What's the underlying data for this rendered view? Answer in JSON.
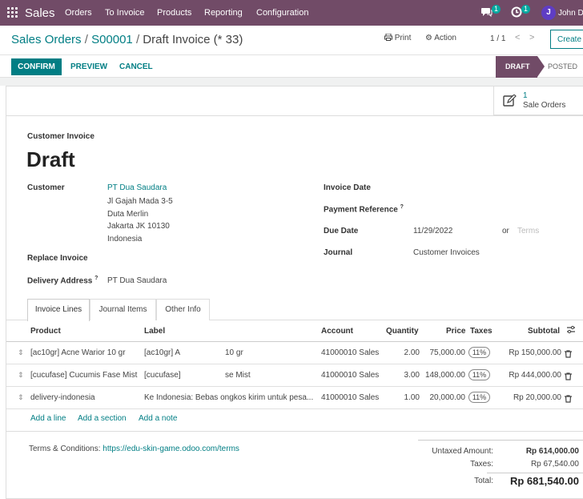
{
  "topbar": {
    "app_name": "Sales",
    "menu": [
      "Orders",
      "To Invoice",
      "Products",
      "Reporting",
      "Configuration"
    ],
    "messages_count": "1",
    "activities_count": "1",
    "user_initial": "J",
    "user_name": "John D",
    "accent": "#714b67"
  },
  "breadcrumb": {
    "root": "Sales Orders",
    "order": "S00001",
    "current": "Draft Invoice (* 33)"
  },
  "control": {
    "print_label": "Print",
    "action_label": "Action",
    "pager": "1 / 1",
    "create_label": "Create"
  },
  "actions": {
    "confirm": "CONFIRM",
    "preview": "PREVIEW",
    "cancel": "CANCEL"
  },
  "statusbar": {
    "draft": "DRAFT",
    "posted": "POSTED"
  },
  "smart_button": {
    "count": "1",
    "label": "Sale Orders"
  },
  "invoice": {
    "type_label": "Customer Invoice",
    "title": "Draft",
    "customer_label": "Customer",
    "customer_address": [
      "PT Dua Saudara",
      "Jl Gajah Mada 3-5",
      "Duta Merlin",
      "Jakarta JK 10130",
      "Indonesia"
    ],
    "replace_invoice_label": "Replace Invoice",
    "delivery_address_label": "Delivery Address",
    "delivery_address_help": "?",
    "delivery_address": "PT Dua Saudara",
    "invoice_date_label": "Invoice Date",
    "payment_ref_label": "Payment Reference",
    "payment_ref_help": "?",
    "due_date_label": "Due Date",
    "due_date": "11/29/2022",
    "or": "or",
    "terms_placeholder": "Terms",
    "journal_label": "Journal",
    "journal": "Customer Invoices"
  },
  "tabs": [
    "Invoice Lines",
    "Journal Items",
    "Other Info"
  ],
  "table": {
    "headers": {
      "product": "Product",
      "label": "Label",
      "account": "Account",
      "quantity": "Quantity",
      "price": "Price",
      "taxes": "Taxes",
      "subtotal": "Subtotal"
    },
    "rows": [
      {
        "product": "[ac10gr] Acne Warior 10 gr",
        "label": "[ac10gr] A",
        "label_tail": "10 gr",
        "account": "41000010 Sales",
        "quantity": "2.00",
        "price": "75,000.00",
        "tax": "11%",
        "subtotal": "Rp 150,000.00"
      },
      {
        "product": "[cucufase] Cucumis Fase Mist",
        "label": "[cucufase]",
        "label_tail": "se Mist",
        "account": "41000010 Sales",
        "quantity": "3.00",
        "price": "148,000.00",
        "tax": "11%",
        "subtotal": "Rp 444,000.00"
      },
      {
        "product": "delivery-indonesia",
        "label": "Ke Indonesia: Bebas ongkos kirim untuk pesa...",
        "label_tail": "",
        "account": "41000010 Sales",
        "quantity": "1.00",
        "price": "20,000.00",
        "tax": "11%",
        "subtotal": "Rp 20,000.00"
      }
    ],
    "add_line": "Add a line",
    "add_section": "Add a section",
    "add_note": "Add a note"
  },
  "footer": {
    "terms_label": "Terms & Conditions:",
    "terms_link": "https://edu-skin-game.odoo.com/terms",
    "untaxed_label": "Untaxed Amount:",
    "untaxed": "Rp 614,000.00",
    "taxes_label": "Taxes:",
    "taxes": "Rp 67,540.00",
    "total_label": "Total:",
    "total": "Rp 681,540.00"
  }
}
